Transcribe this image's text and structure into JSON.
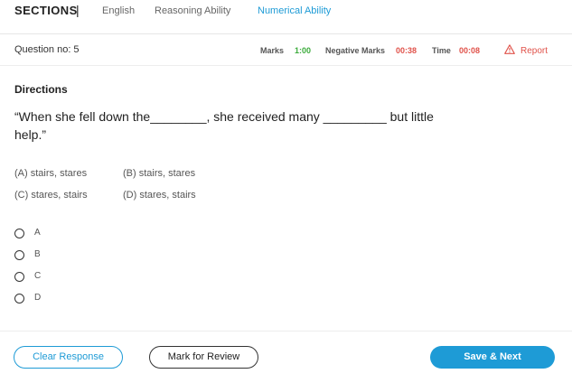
{
  "sections": {
    "title": "SECTIONS",
    "separator": "|",
    "tabs": [
      {
        "label": "English"
      },
      {
        "label": "Reasoning Ability"
      },
      {
        "label": "Numerical Ability"
      }
    ],
    "active_tab": "Numerical Ability",
    "active_color": "#1e9bd6"
  },
  "question_header": {
    "question_no": "Question no: 5",
    "marks_label": "Marks",
    "marks_value": "1:00",
    "negative_marks_label": "Negative Marks",
    "negative_marks_value": "00:38",
    "time_label": "Time",
    "time_value": "00:08",
    "report_label": "Report",
    "report_icon": "warning-triangle-icon",
    "positive_color": "#3cab3c",
    "negative_color": "#e0524a"
  },
  "question": {
    "directions_label": "Directions",
    "text": "“When she fell down the________, she received many _________ but little help.”",
    "options": [
      "(A) stairs, stares",
      "(B) stairs, stares",
      "(C) stares, stairs",
      "(D) stares, stairs"
    ],
    "choices": [
      "A",
      "B",
      "C",
      "D"
    ]
  },
  "footer": {
    "clear_label": "Clear Response",
    "review_label": "Mark for Review",
    "save_label": "Save & Next"
  }
}
